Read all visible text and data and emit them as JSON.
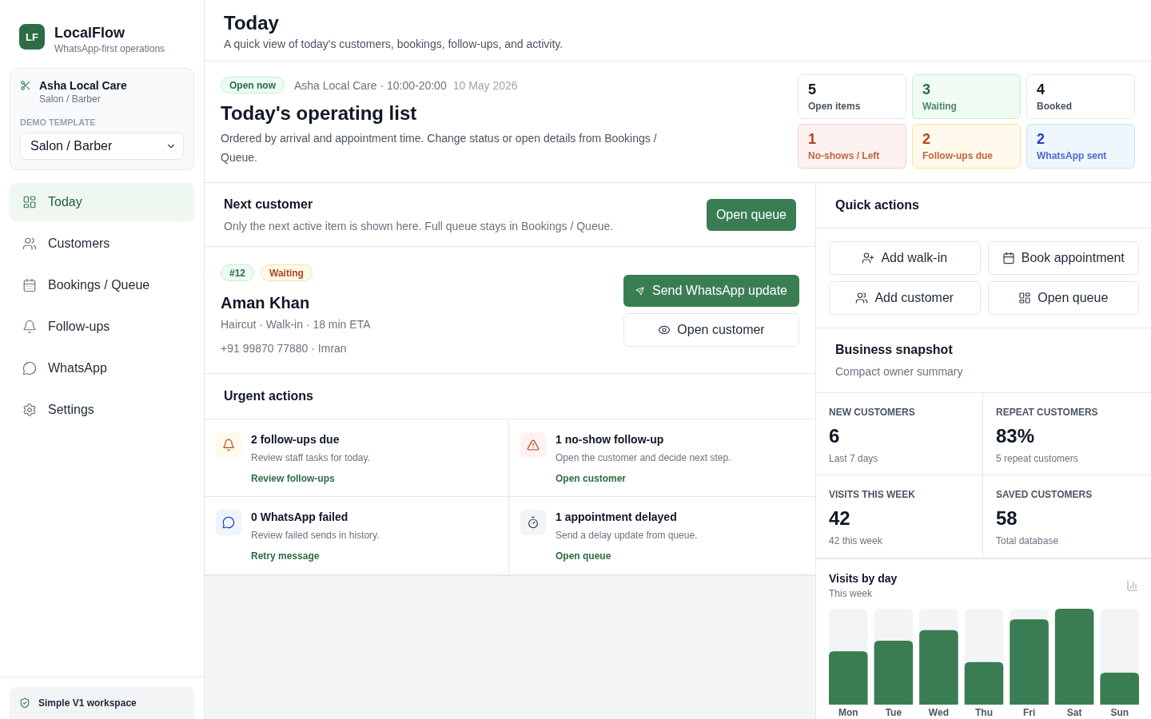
{
  "sidebar": {
    "brand": {
      "logo": "LF",
      "name": "LocalFlow",
      "tagline": "WhatsApp-first operations"
    },
    "workspace": {
      "name": "Asha Local Care",
      "type": "Salon / Barber",
      "template_label": "DEMO TEMPLATE",
      "template_value": "Salon / Barber"
    },
    "nav": [
      {
        "label": "Today",
        "selected": true
      },
      {
        "label": "Customers",
        "selected": false
      },
      {
        "label": "Bookings / Queue",
        "selected": false
      },
      {
        "label": "Follow-ups",
        "selected": false
      },
      {
        "label": "WhatsApp",
        "selected": false
      },
      {
        "label": "Settings",
        "selected": false
      }
    ],
    "footer": {
      "title": "Simple V1 workspace"
    }
  },
  "header": {
    "title": "Today",
    "subtitle": "A quick view of today's customers, bookings, follow-ups, and activity."
  },
  "overview": {
    "status_badge": "Open now",
    "business_line": "Asha Local Care · 10:00-20:00",
    "date": "10 May 2026",
    "title": "Today's operating list",
    "description": "Ordered by arrival and appointment time. Change status or open details from Bookings / Queue.",
    "stats": [
      {
        "value": "5",
        "label": "Open items",
        "kind": "neutral"
      },
      {
        "value": "3",
        "label": "Waiting",
        "kind": "success"
      },
      {
        "value": "4",
        "label": "Booked",
        "kind": "neutral"
      },
      {
        "value": "1",
        "label": "No-shows / Left",
        "kind": "danger"
      },
      {
        "value": "2",
        "label": "Follow-ups due",
        "kind": "warning"
      },
      {
        "value": "2",
        "label": "WhatsApp sent",
        "kind": "info"
      }
    ]
  },
  "next_customer": {
    "title": "Next customer",
    "subtitle": "Only the next active item is shown here. Full queue stays in Bookings / Queue.",
    "button": "Open queue",
    "badges": [
      {
        "text": "#12",
        "kind": "success"
      },
      {
        "text": "Waiting",
        "kind": "warning"
      }
    ],
    "name": "Aman Khan",
    "details": "Haircut · Walk-in · 18 min ETA",
    "contact": "+91 99870 77880 · Imran",
    "primary_action": "Send WhatsApp update",
    "secondary_action": "Open customer"
  },
  "urgent_actions": {
    "title": "Urgent actions",
    "items": [
      {
        "title": "2 follow-ups due",
        "description": "Review staff tasks for today.",
        "link": "Review follow-ups",
        "kind": "warning"
      },
      {
        "title": "1 no-show follow-up",
        "description": "Open the customer and decide next step.",
        "link": "Open customer",
        "kind": "danger"
      },
      {
        "title": "0 WhatsApp failed",
        "description": "Review failed sends in history.",
        "link": "Retry message",
        "kind": "info"
      },
      {
        "title": "1 appointment delayed",
        "description": "Send a delay update from queue.",
        "link": "Open queue",
        "kind": "neutral"
      }
    ]
  },
  "quick_actions": {
    "title": "Quick actions",
    "buttons": [
      "Add walk-in",
      "Book appointment",
      "Add customer",
      "Open queue"
    ]
  },
  "business_snapshot": {
    "title": "Business snapshot",
    "subtitle": "Compact owner summary",
    "metrics": [
      {
        "label": "NEW CUSTOMERS",
        "value": "6",
        "note": "Last 7 days"
      },
      {
        "label": "REPEAT CUSTOMERS",
        "value": "83%",
        "note": "5 repeat customers"
      },
      {
        "label": "VISITS THIS WEEK",
        "value": "42",
        "note": "42 this week"
      },
      {
        "label": "SAVED CUSTOMERS",
        "value": "58",
        "note": "Total database"
      }
    ],
    "visits": {
      "title": "Visits by day",
      "subtitle": "This week",
      "days": [
        "Mon",
        "Tue",
        "Wed",
        "Thu",
        "Fri",
        "Sat",
        "Sun"
      ]
    }
  }
}
